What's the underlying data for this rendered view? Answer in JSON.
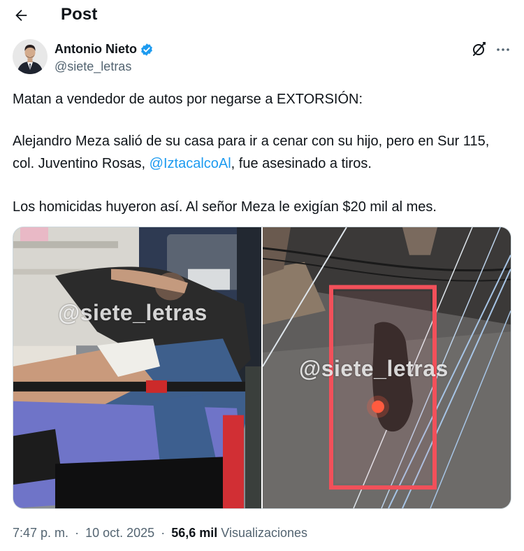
{
  "header": {
    "back_icon": "arrow-left-icon",
    "title": "Post"
  },
  "author": {
    "name": "Antonio Nieto",
    "handle": "@siete_letras",
    "verified_color": "#1d9bf0"
  },
  "tweet": {
    "line1": "Matan a vendedor de autos por negarse a EXTORSIÓN:",
    "p2_before": "Alejandro Meza salió de su casa para ir a cenar con su hijo, pero en Sur 115, col. Juventino Rosas, ",
    "mention": "@IztacalcoAl",
    "p2_after": ", fue asesinado a tiros.",
    "line3": "Los homicidas huyeron así. Al señor Meza le exigían $20 mil al mes."
  },
  "media": {
    "left_watermark": "@siete_letras",
    "right_watermark": "@siete_letras"
  },
  "meta": {
    "time": "7:47 p. m.",
    "date": "10 oct. 2025",
    "separator": "·",
    "views_count": "56,6 mil",
    "views_label": "Visualizaciones"
  },
  "colors": {
    "accent": "#1d9bf0",
    "secondary_text": "#536471",
    "primary_text": "#0f1419"
  }
}
